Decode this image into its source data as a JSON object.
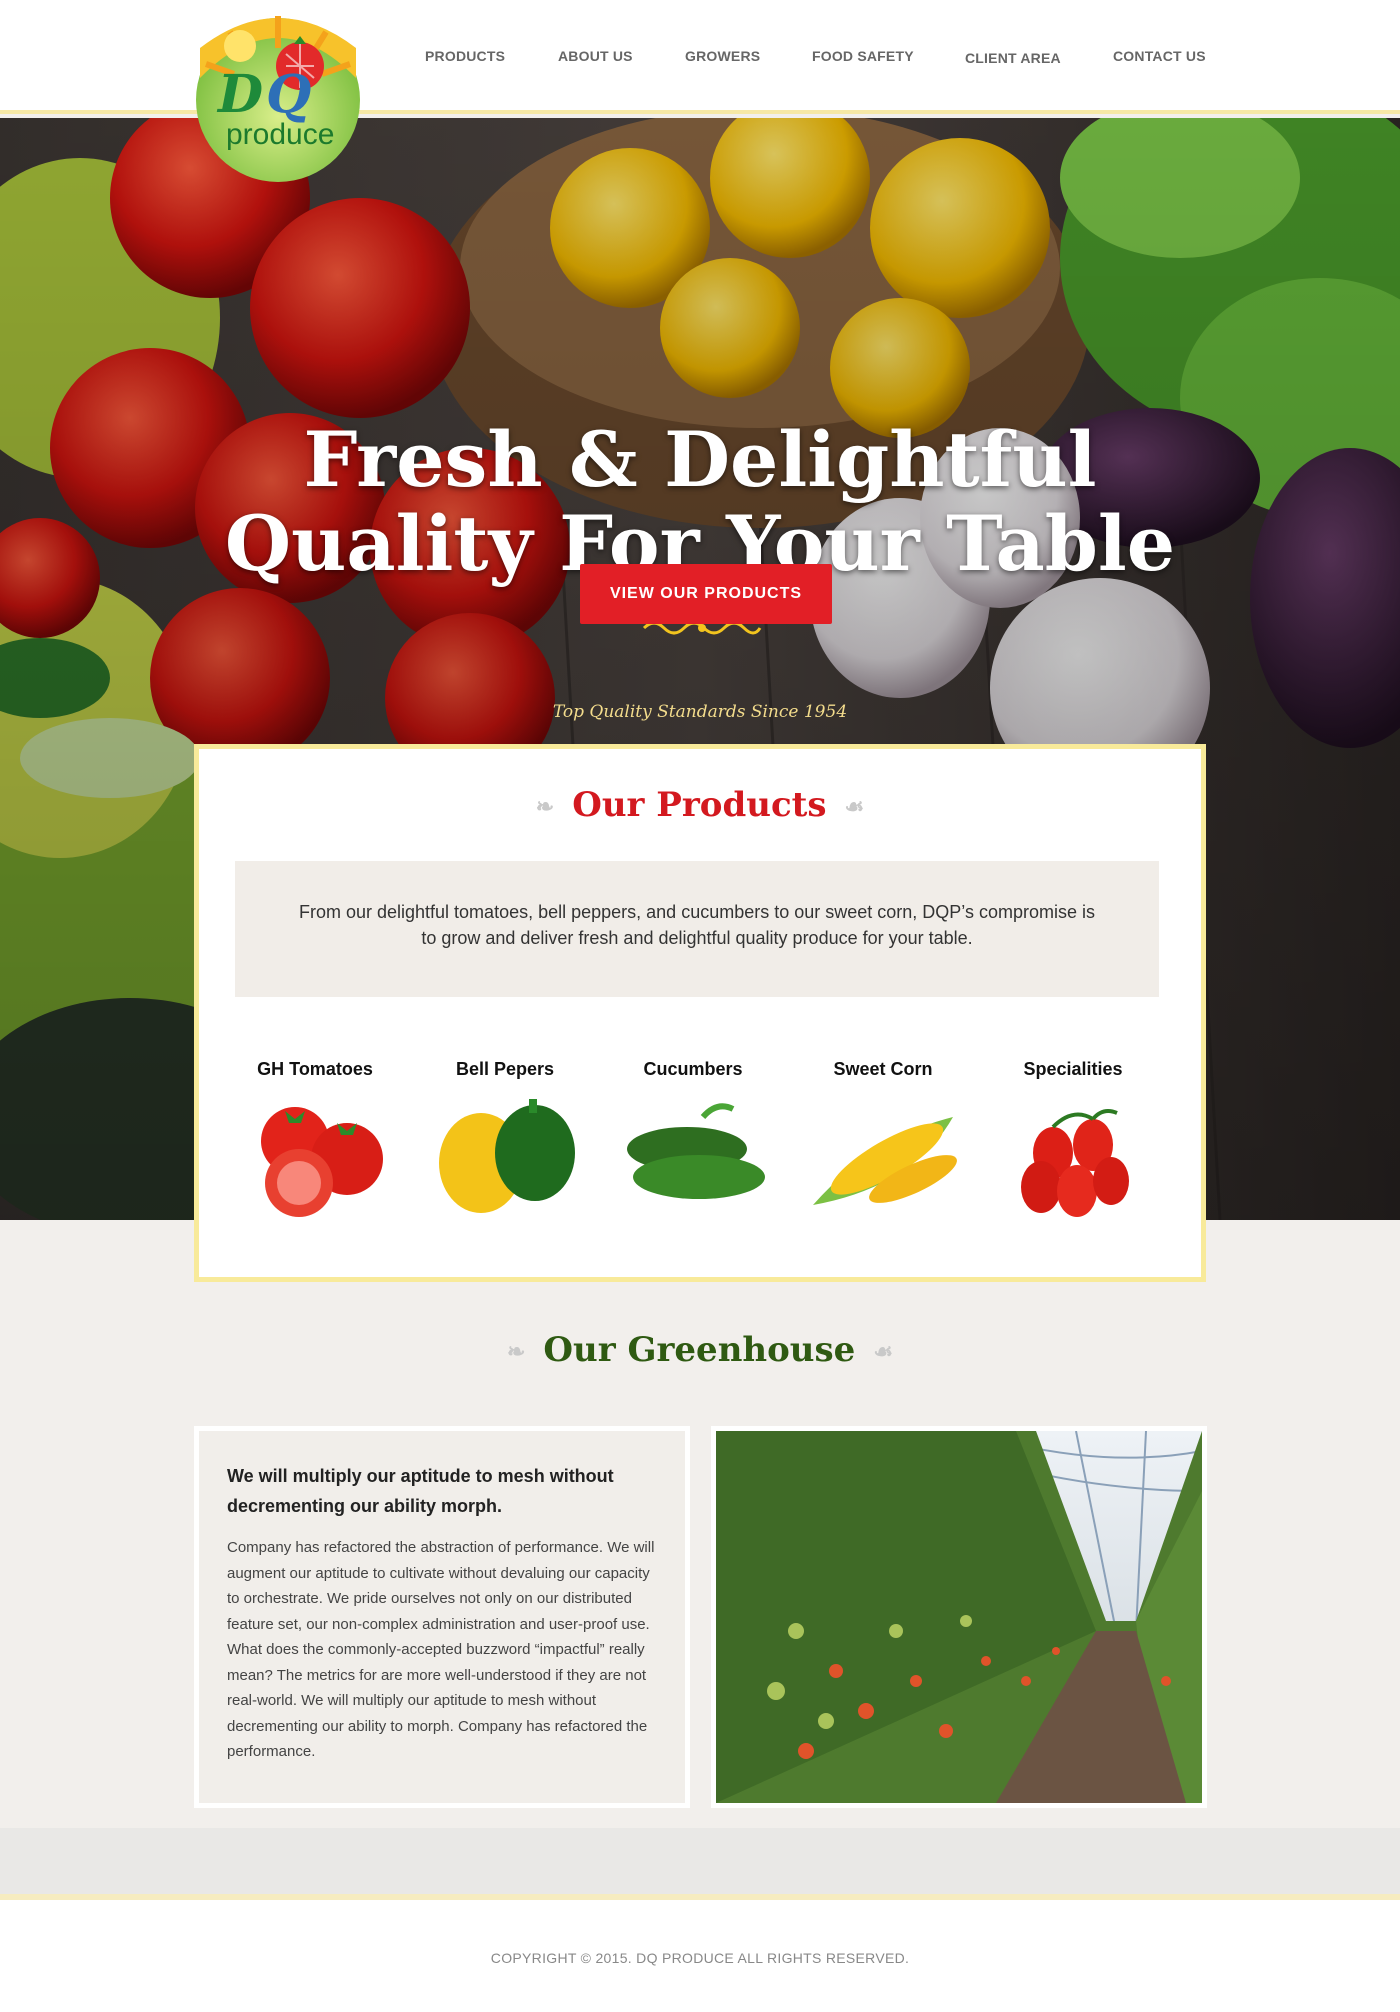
{
  "brand": {
    "logo_text": "produce",
    "logo_initials": "DQ",
    "logo_tagline": "fresh and delightful quality for your table"
  },
  "nav": {
    "items": [
      "PRODUCTS",
      "ABOUT US",
      "GROWERS",
      "FOOD SAFETY",
      "CLIENT AREA",
      "CONTACT US"
    ]
  },
  "hero": {
    "title_line1": "Fresh & Delightful",
    "title_line2": "Quality For Your Table",
    "cta_label": "VIEW OUR PRODUCTS",
    "subtitle": "Top Quality Standards Since 1954"
  },
  "products": {
    "title": "Our Products",
    "intro": "From our delightful tomatoes, bell peppers, and cucumbers to our sweet corn, DQP’s compromise is to grow and deliver fresh and delightful quality produce for your table.",
    "items": [
      {
        "name": "GH Tomatoes",
        "icon": "tomatoes-icon"
      },
      {
        "name": "Bell Pepers",
        "icon": "bell-peppers-icon"
      },
      {
        "name": "Cucumbers",
        "icon": "cucumbers-icon"
      },
      {
        "name": "Sweet Corn",
        "icon": "sweet-corn-icon"
      },
      {
        "name": "Specialities",
        "icon": "roma-tomatoes-icon"
      }
    ]
  },
  "greenhouse": {
    "title": "Our Greenhouse",
    "heading": "We will multiply our aptitude to mesh without decrementing our ability  morph.",
    "body": "Company has refactored the abstraction of performance. We will augment our aptitude to cultivate without devaluing our capacity to orchestrate. We pride ourselves not only on our distributed feature set, our non-complex administration and user-proof use. What does the commonly-accepted buzzword “impactful” really mean? The metrics for are more well-understood if they are not real-world. We will multiply our aptitude to mesh without decrementing our ability to morph. Company has refactored the performance."
  },
  "footer": {
    "copyright": "COPYRIGHT © 2015. DQ PRODUCE ALL RIGHTS RESERVED."
  },
  "colors": {
    "accent_red": "#e21f26",
    "title_red": "#d3191f",
    "greenhouse_green": "#2f5a12",
    "border_yellow": "#f8ea9a"
  }
}
